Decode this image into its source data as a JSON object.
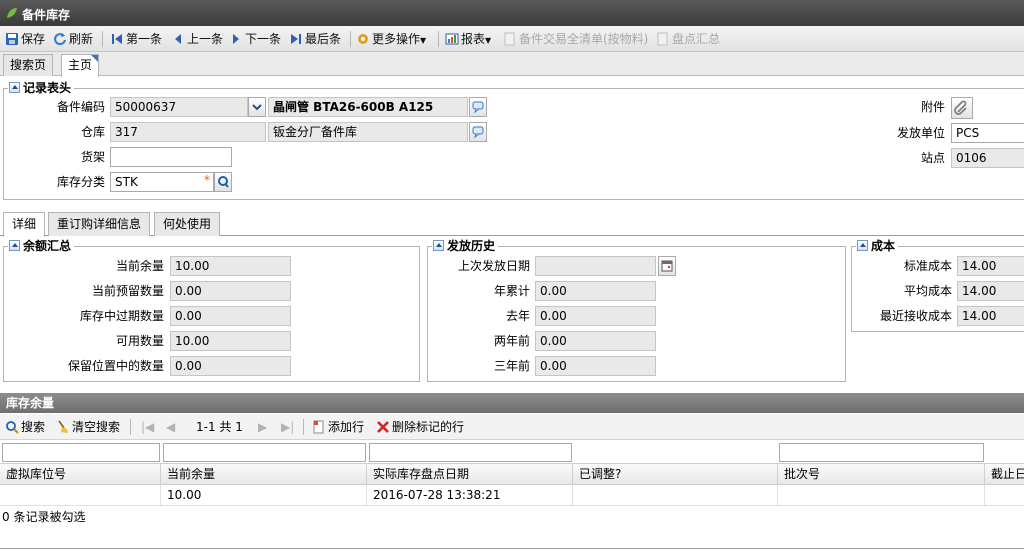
{
  "window": {
    "title": "备件库存"
  },
  "toolbar": {
    "save": "保存",
    "refresh": "刷新",
    "first": "第一条",
    "prev": "上一条",
    "next": "下一条",
    "last": "最后条",
    "more": "更多操作",
    "report": "报表",
    "txn_list": "备件交易全清单(按物料)",
    "stocktake": "盘点汇总"
  },
  "page_tabs": [
    "搜索页",
    "主页"
  ],
  "record_header": {
    "title": "记录表头",
    "part_code_label": "备件编码",
    "part_code": "50000637",
    "part_desc": "晶闸管 BTA26-600B A125",
    "warehouse_label": "仓库",
    "warehouse": "317",
    "warehouse_desc": "钣金分厂备件库",
    "shelf_label": "货架",
    "shelf": "",
    "category_label": "库存分类",
    "category": "STK",
    "required_mark": "*",
    "attachment_label": "附件",
    "issue_unit_label": "发放单位",
    "issue_unit": "PCS",
    "site_label": "站点",
    "site": "0106"
  },
  "sub_tabs": [
    "详细",
    "重订购详细信息",
    "何处使用"
  ],
  "balance": {
    "title": "余额汇总",
    "rows": [
      {
        "label": "当前余量",
        "value": "10.00"
      },
      {
        "label": "当前预留数量",
        "value": "0.00"
      },
      {
        "label": "库存中过期数量",
        "value": "0.00"
      },
      {
        "label": "可用数量",
        "value": "10.00"
      },
      {
        "label": "保留位置中的数量",
        "value": "0.00"
      }
    ]
  },
  "issue_history": {
    "title": "发放历史",
    "rows": [
      {
        "label": "上次发放日期",
        "value": ""
      },
      {
        "label": "年累计",
        "value": "0.00"
      },
      {
        "label": "去年",
        "value": "0.00"
      },
      {
        "label": "两年前",
        "value": "0.00"
      },
      {
        "label": "三年前",
        "value": "0.00"
      }
    ]
  },
  "cost": {
    "title": "成本",
    "rows": [
      {
        "label": "标准成本",
        "value": "14.00"
      },
      {
        "label": "平均成本",
        "value": "14.00"
      },
      {
        "label": "最近接收成本",
        "value": "14.00"
      }
    ]
  },
  "inventory_grid": {
    "title": "库存余量",
    "search": "搜索",
    "clear_search": "清空搜索",
    "pager": "1-1 共 1",
    "add_row": "添加行",
    "delete_marked": "删除标记的行",
    "columns": [
      "虚拟库位号",
      "当前余量",
      "实际库存盘点日期",
      "已调整?",
      "批次号",
      "截止日"
    ],
    "rows": [
      [
        "",
        "10.00",
        "2016-07-28 13:38:21",
        "",
        "",
        ""
      ]
    ],
    "status": "0 条记录被勾选"
  },
  "colors": {
    "title_bar": "#3f3f3f",
    "grid_bar": "#7a7a7a",
    "accent": "#3a76c4"
  }
}
